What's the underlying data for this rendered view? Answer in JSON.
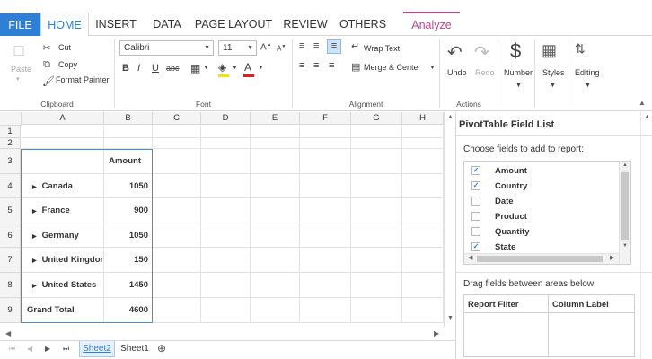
{
  "tabs": [
    "FILE",
    "HOME",
    "INSERT",
    "DATA",
    "PAGE LAYOUT",
    "REVIEW",
    "OTHERS",
    "Analyze"
  ],
  "clipboard": {
    "paste": "Paste",
    "cut": "Cut",
    "copy": "Copy",
    "format_painter": "Format Painter",
    "label": "Clipboard"
  },
  "font": {
    "name": "Calibri",
    "size": "11",
    "label": "Font"
  },
  "alignment": {
    "wrap_text": "Wrap Text",
    "merge_center": "Merge & Center",
    "label": "Alignment"
  },
  "actions": {
    "undo": "Undo",
    "redo": "Redo",
    "label": "Actions"
  },
  "misc": {
    "number": "Number",
    "styles": "Styles",
    "editing": "Editing"
  },
  "columns": [
    "A",
    "B",
    "C",
    "D",
    "E",
    "F",
    "G",
    "H"
  ],
  "rows": [
    "1",
    "2",
    "3",
    "4",
    "5",
    "6",
    "7",
    "8",
    "9"
  ],
  "pivot_table": {
    "header": "Amount",
    "rows": [
      {
        "label": "Canada",
        "value": "1050"
      },
      {
        "label": "France",
        "value": "900"
      },
      {
        "label": "Germany",
        "value": "1050"
      },
      {
        "label": "United Kingdom",
        "value": "150"
      },
      {
        "label": "United States",
        "value": "1450"
      }
    ],
    "total_label": "Grand Total",
    "total_value": "4600"
  },
  "sheets": [
    "Sheet2",
    "Sheet1"
  ],
  "field_list": {
    "title": "PivotTable Field List",
    "choose_label": "Choose fields to add to report:",
    "fields": [
      {
        "name": "Amount",
        "checked": true
      },
      {
        "name": "Country",
        "checked": true
      },
      {
        "name": "Date",
        "checked": false
      },
      {
        "name": "Product",
        "checked": false
      },
      {
        "name": "Quantity",
        "checked": false
      },
      {
        "name": "State",
        "checked": true
      }
    ],
    "drag_label": "Drag fields between areas below:",
    "report_filter": "Report Filter",
    "column_label": "Column Label"
  },
  "colors": {
    "accent": "#2e7fd6",
    "analyze": "#c0468a",
    "pivot_border": "#4a90c8"
  }
}
